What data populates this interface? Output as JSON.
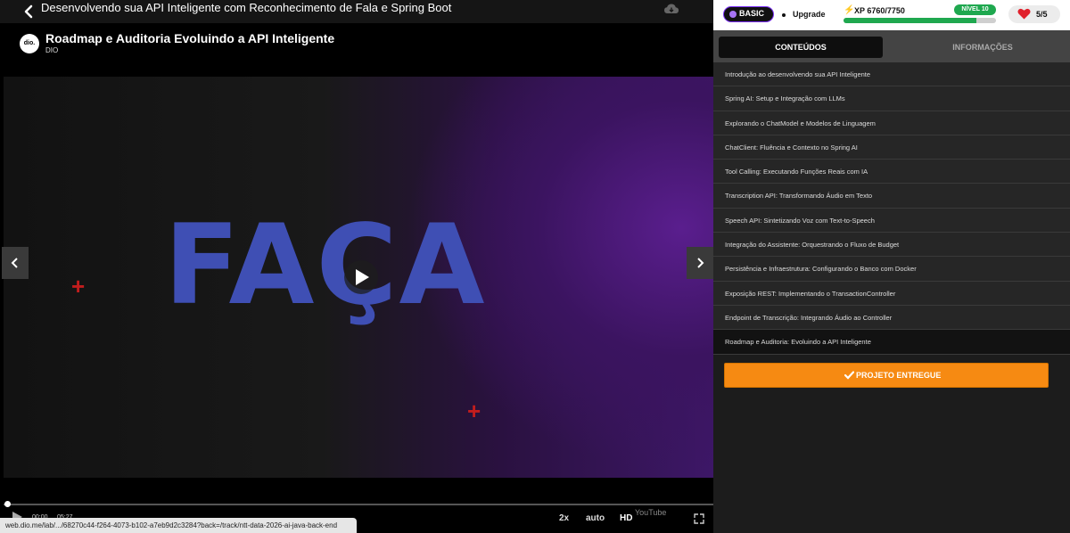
{
  "header": {
    "course_title": "Desenvolvendo sua API Inteligente com Reconhecimento de Fala e Spring Boot"
  },
  "video": {
    "title": "Roadmap e Auditoria Evoluindo a API Inteligente",
    "channel_logo": "dio.",
    "channel_name": "DIO",
    "frame_word": "FAÇA",
    "cross_symbol": "+",
    "time_current": "00:00",
    "time_total": "05:27",
    "speed_label": "2x",
    "quality_auto_label": "auto",
    "hd_label": "HD",
    "brand_watermark": "YouTube",
    "progress_fraction": 0.0
  },
  "status_url": "web.dio.me/lab/.../68270c44-f264-4073-b102-a7eb9d2c3284?back=/track/ntt-data-2026-ai-java-back-end",
  "user": {
    "plan": "BASIC",
    "upgrade": "Upgrade",
    "xp_text": "XP 6760/7750",
    "xp_fraction": 0.872,
    "level": "NÍVEL 10",
    "lives": "5/5"
  },
  "tabs": {
    "contents": "CONTEÚDOS",
    "info": "INFORMAÇÕES"
  },
  "lessons": [
    "Introdução ao desenvolvendo sua API Inteligente",
    "Spring AI: Setup e Integração com LLMs",
    "Explorando o ChatModel e Modelos de Linguagem",
    "ChatClient: Fluência e Contexto no Spring AI",
    "Tool Calling: Executando Funções Reais com IA",
    "Transcription API: Transformando Áudio em Texto",
    "Speech API: Sintetizando Voz com Text-to-Speech",
    "Integração do Assistente: Orquestrando o Fluxo de Budget",
    "Persistência e Infraestrutura: Configurando o Banco com Docker",
    "Exposição REST: Implementando o TransactionController",
    "Endpoint de Transcrição: Integrando Áudio ao Controller",
    "Roadmap e Auditoria: Evoluindo a API Inteligente"
  ],
  "current_lesson_index": 11,
  "deliver_button": "PROJETO ENTREGUE",
  "colors": {
    "accent_orange": "#f68a12",
    "level_green": "#1fa84f",
    "plan_purple": "#7b2ff7",
    "heart_red": "#e0202b"
  }
}
